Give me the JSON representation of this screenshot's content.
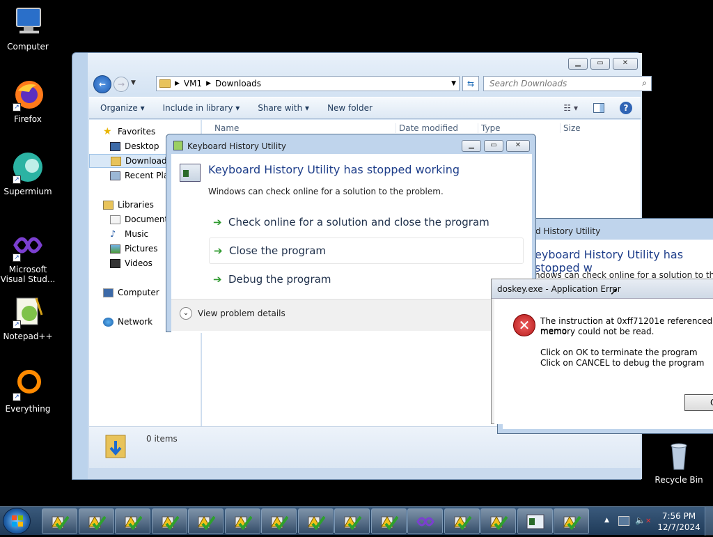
{
  "desktop": {
    "icons": [
      {
        "label": "Computer",
        "icon": "computer-icon"
      },
      {
        "label": "Firefox",
        "icon": "firefox-icon"
      },
      {
        "label": "Supermium",
        "icon": "supermium-icon"
      },
      {
        "label": "Microsoft Visual Stud...",
        "icon": "visual-studio-icon"
      },
      {
        "label": "Notepad++",
        "icon": "notepadpp-icon"
      },
      {
        "label": "Everything",
        "icon": "everything-icon"
      },
      {
        "label": "Recycle Bin",
        "icon": "recycle-bin-icon"
      }
    ]
  },
  "explorer": {
    "address": [
      "VM1",
      "Downloads"
    ],
    "search_placeholder": "Search Downloads",
    "commands": [
      "Organize ▾",
      "Include in library ▾",
      "Share with ▾",
      "New folder"
    ],
    "columns": [
      "Name",
      "Date modified",
      "Type",
      "Size"
    ],
    "nav": {
      "favorites": "Favorites",
      "desktop": "Desktop",
      "downloads": "Downloads",
      "recent": "Recent Plac",
      "libraries": "Libraries",
      "documents": "Document",
      "music": "Music",
      "pictures": "Pictures",
      "videos": "Videos",
      "computer": "Computer",
      "network": "Network"
    },
    "status_items": "0 items"
  },
  "crash_dialog": {
    "title": "Keyboard History Utility",
    "heading": "Keyboard History Utility has stopped working",
    "subtitle": "Windows can check online for a solution to the problem.",
    "options": [
      "Check online for a solution and close the program",
      "Close the program",
      "Debug the program"
    ],
    "details": "View problem details"
  },
  "crash_dialog_back": {
    "title": "d History Utility",
    "heading": "eyboard History Utility has stopped w",
    "subtitle": "ndows can check online for a solution to the pro"
  },
  "error_box": {
    "title": "doskey.exe - Application Error",
    "message_1": "The instruction at 0xff71201e referenced memo",
    "message_2": "memory could not be read.",
    "message_3": "Click on OK to terminate the program",
    "message_4": "Click on CANCEL to debug the program",
    "ok": "O"
  },
  "taskbar": {
    "time": "7:56 PM",
    "date": "12/7/2024"
  }
}
